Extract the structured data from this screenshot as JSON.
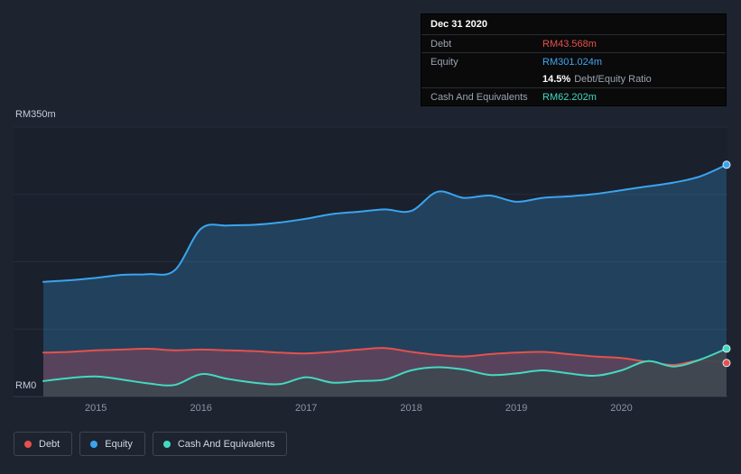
{
  "tooltip": {
    "date": "Dec 31 2020",
    "debt_label": "Debt",
    "debt_value": "RM43.568m",
    "equity_label": "Equity",
    "equity_value": "RM301.024m",
    "ratio_value": "14.5%",
    "ratio_label": "Debt/Equity Ratio",
    "cash_label": "Cash And Equivalents",
    "cash_value": "RM62.202m"
  },
  "legend": {
    "items": [
      {
        "label": "Debt",
        "color": "#e6514d"
      },
      {
        "label": "Equity",
        "color": "#3aa5f0"
      },
      {
        "label": "Cash And Equivalents",
        "color": "#43d9c0"
      }
    ]
  },
  "colors": {
    "background": "#1d2430",
    "panel": "#1a202c",
    "gridline": "#262e3b",
    "baseline": "#333d4b",
    "debt": "#e6514d",
    "equity": "#3aa5f0",
    "cash": "#43d9c0"
  },
  "chart_data": {
    "type": "area",
    "title": "",
    "x_unit": "year",
    "y_unit": "RM millions",
    "ylim": [
      0,
      350
    ],
    "y_gridlines": [
      0,
      87.5,
      175,
      262.5,
      350
    ],
    "y_axis_labels": {
      "top": "RM350m",
      "bottom": "RM0"
    },
    "x_ticks": [
      2015,
      2016,
      2017,
      2018,
      2019,
      2020
    ],
    "grid": true,
    "legend_position": "bottom-left",
    "x": [
      2014.5,
      2014.75,
      2015,
      2015.25,
      2015.5,
      2015.75,
      2016,
      2016.25,
      2016.5,
      2016.75,
      2017,
      2017.25,
      2017.5,
      2017.75,
      2018,
      2018.25,
      2018.5,
      2018.75,
      2019,
      2019.25,
      2019.5,
      2019.75,
      2020,
      2020.25,
      2020.5,
      2020.75,
      2021
    ],
    "series": [
      {
        "name": "Equity",
        "key": "equity",
        "z": 0,
        "color": "#3aa5f0",
        "fill": "rgba(58,165,240,0.25)",
        "values": [
          149,
          151,
          154,
          158,
          159,
          164,
          218,
          222,
          223,
          226,
          231,
          237,
          240,
          243,
          241,
          266,
          258,
          261,
          253,
          258,
          260,
          263,
          268,
          273,
          278,
          286,
          301.024
        ]
      },
      {
        "name": "Debt",
        "key": "debt",
        "z": 1,
        "color": "#e6514d",
        "fill": "rgba(225,80,90,0.28)",
        "values": [
          57,
          58,
          60,
          61,
          62,
          60,
          61,
          60,
          59,
          57,
          56,
          58,
          61,
          63,
          58,
          54,
          52,
          55,
          57,
          58,
          55,
          52,
          50,
          45,
          41,
          47,
          43.568
        ]
      },
      {
        "name": "Cash And Equivalents",
        "key": "cash",
        "z": 2,
        "color": "#43d9c0",
        "fill": "rgba(62,72,80,0.92)",
        "values": [
          20,
          24,
          26,
          22,
          17,
          15,
          29,
          23,
          18,
          16,
          25,
          18,
          20,
          22,
          34,
          38,
          35,
          28,
          30,
          34,
          30,
          27,
          34,
          46,
          39,
          48,
          62.202
        ]
      }
    ]
  }
}
